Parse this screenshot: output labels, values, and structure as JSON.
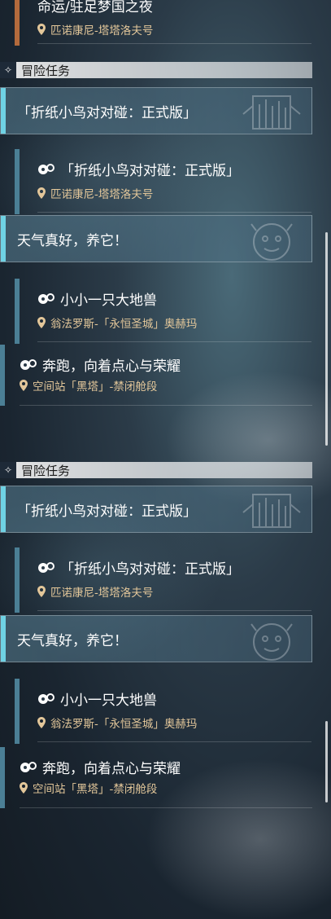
{
  "top_item": {
    "name": "命运/驻足梦国之夜",
    "location": "匹诺康尼-塔塔洛夫号"
  },
  "panels": [
    {
      "section_title": "冒险任务",
      "groups": [
        {
          "header": "「折纸小鸟对对碰：正式版」",
          "emblem": "building-emblem-icon",
          "sub": {
            "name": "「折纸小鸟对对碰：正式版」",
            "location": "匹诺康尼-塔塔洛夫号"
          }
        },
        {
          "header": "天气真好，养它！",
          "emblem": "mascot-emblem-icon",
          "sub": {
            "name": "小小一只大地兽",
            "location": "翁法罗斯-「永恒圣城」奥赫玛"
          }
        }
      ],
      "free": {
        "name": "奔跑，向着点心与荣耀",
        "location": "空间站「黑塔」-禁闭舱段"
      }
    },
    {
      "section_title": "冒险任务",
      "groups": [
        {
          "header": "「折纸小鸟对对碰：正式版」",
          "emblem": "building-emblem-icon",
          "sub": {
            "name": "「折纸小鸟对对碰：正式版」",
            "location": "匹诺康尼-塔塔洛夫号"
          }
        },
        {
          "header": "天气真好，养它！",
          "emblem": "mascot-emblem-icon",
          "sub": {
            "name": "小小一只大地兽",
            "location": "翁法罗斯-「永恒圣城」奥赫玛"
          }
        }
      ],
      "free": {
        "name": "奔跑，向着点心与荣耀",
        "location": "空间站「黑塔」-禁闭舱段"
      }
    }
  ],
  "colors": {
    "accent_cyan": "#6fd2e4",
    "bar_teal": "#4b7f95",
    "top_bar_orange": "#b36a3c",
    "location_gold": "#e3c79a"
  }
}
